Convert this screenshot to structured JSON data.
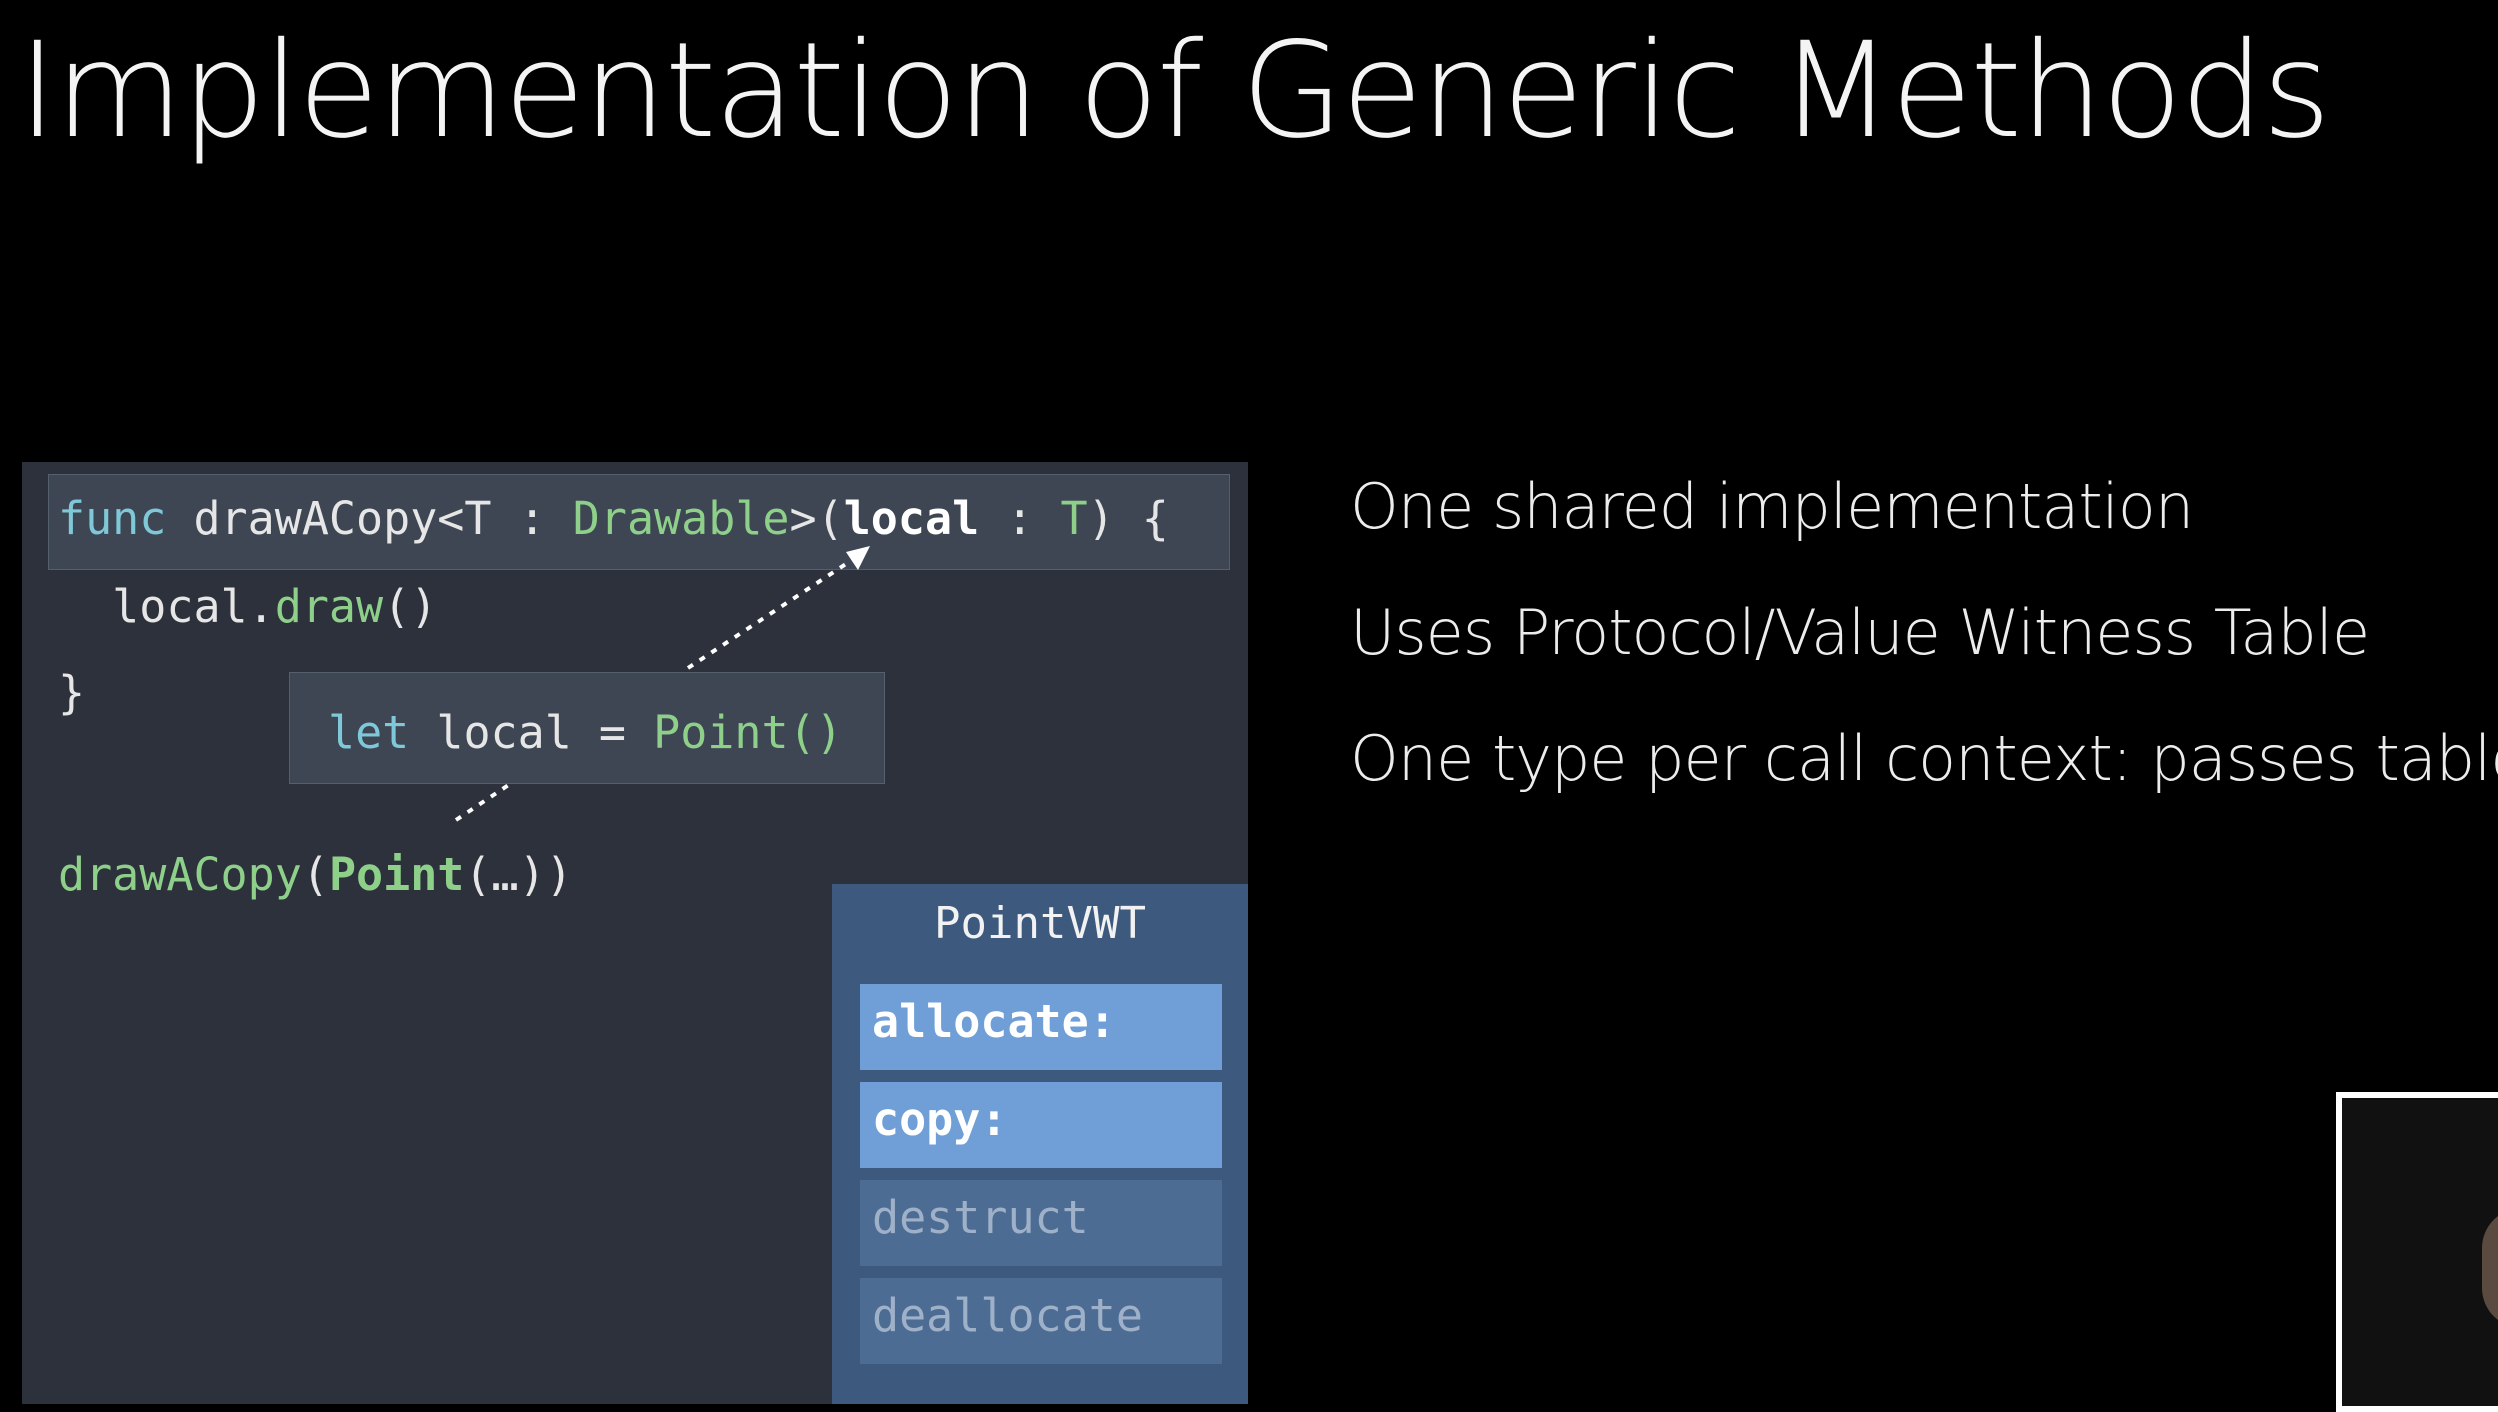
{
  "slide": {
    "title": "Implementation of Generic Methods",
    "bullets": [
      "One shared implementation",
      "Uses Protocol/Value Witness Table",
      "One type per call context: passes tables"
    ]
  },
  "code": {
    "sig": {
      "func": "func",
      "name": " drawACopy<T : ",
      "proto": "Drawable",
      "gt": ">(",
      "local": "local",
      "colon": " : ",
      "T": "T",
      "end": ") {"
    },
    "body": {
      "indent": "  local.",
      "draw": "draw",
      "parens": "()"
    },
    "close": "}",
    "let_line": {
      "let": "let",
      "mid": " local = ",
      "point": "Point()"
    },
    "call": {
      "fn": "drawACopy",
      "open": "(",
      "point": "Point",
      "args": "(…))"
    }
  },
  "vwt": {
    "title": "PointVWT",
    "rows": [
      {
        "label": "allocate:",
        "active": true
      },
      {
        "label": "copy:",
        "active": true
      },
      {
        "label": "destruct",
        "active": false
      },
      {
        "label": "deallocate",
        "active": false
      }
    ]
  },
  "colors": {
    "background": "#000000",
    "panel": "#2d313b",
    "keyword": "#7ec8d8",
    "type": "#8ed08a",
    "vwt_bg": "#3d5a7e",
    "vwt_active": "#6f9fd6",
    "vwt_inactive": "#4d6c94"
  }
}
